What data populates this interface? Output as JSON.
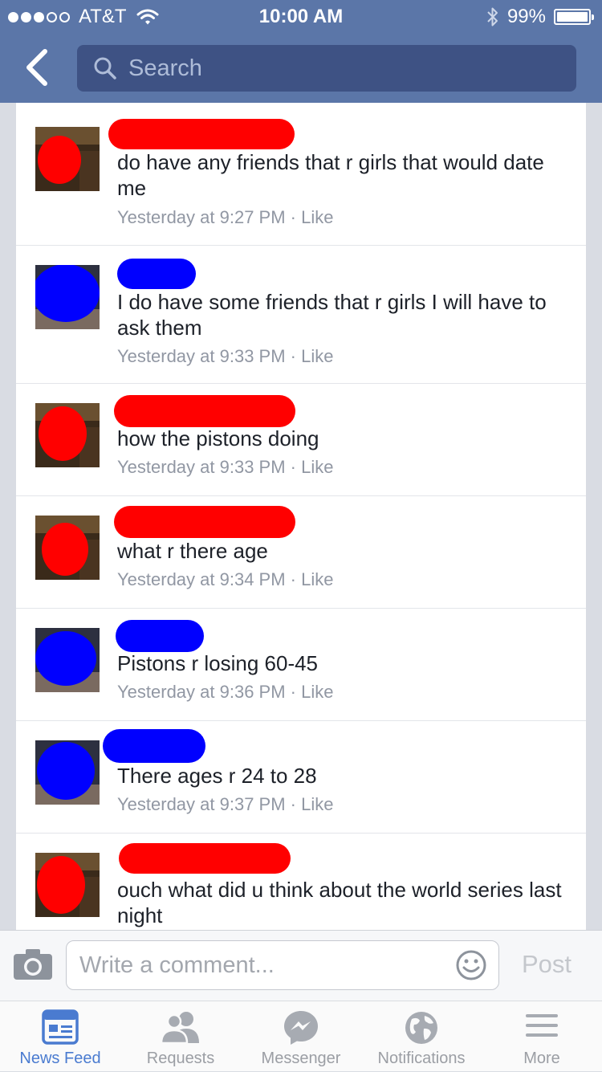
{
  "status_bar": {
    "carrier": "AT&T",
    "time": "10:00 AM",
    "battery": "99%",
    "battery_level": 0.99
  },
  "header": {
    "search_placeholder": "Search"
  },
  "comments": [
    {
      "text": "do have any friends that r girls that would date me",
      "time": "Yesterday at 9:27 PM",
      "like_label": "Like",
      "redaction_color": "#ff0000"
    },
    {
      "text": "I do have some friends that r girls I will have to ask them",
      "time": "Yesterday at 9:33 PM",
      "like_label": "Like",
      "redaction_color": "#0000ff"
    },
    {
      "text": "how the pistons doing",
      "time": "Yesterday at 9:33 PM",
      "like_label": "Like",
      "redaction_color": "#ff0000"
    },
    {
      "text": "what r there age",
      "time": "Yesterday at 9:34 PM",
      "like_label": "Like",
      "redaction_color": "#ff0000"
    },
    {
      "text": "Pistons r losing 60-45",
      "time": "Yesterday at 9:36 PM",
      "like_label": "Like",
      "redaction_color": "#0000ff"
    },
    {
      "text": "There ages r 24 to 28",
      "time": "Yesterday at 9:37 PM",
      "like_label": "Like",
      "redaction_color": "#0000ff"
    },
    {
      "text": "ouch what did u think about the world series last night",
      "time": "",
      "like_label": "",
      "redaction_color": "#ff0000"
    }
  ],
  "composer": {
    "placeholder": "Write a comment...",
    "post_label": "Post"
  },
  "tabs": [
    {
      "label": "News Feed",
      "icon": "news-feed-icon",
      "active": true
    },
    {
      "label": "Requests",
      "icon": "friend-requests-icon",
      "active": false
    },
    {
      "label": "Messenger",
      "icon": "messenger-icon",
      "active": false
    },
    {
      "label": "Notifications",
      "icon": "globe-icon",
      "active": false
    },
    {
      "label": "More",
      "icon": "menu-icon",
      "active": false
    }
  ],
  "colors": {
    "header": "#5b76a8",
    "search_field": "#3e5284",
    "active_tab": "#4a7bd0",
    "meta_text": "#9197a3"
  }
}
